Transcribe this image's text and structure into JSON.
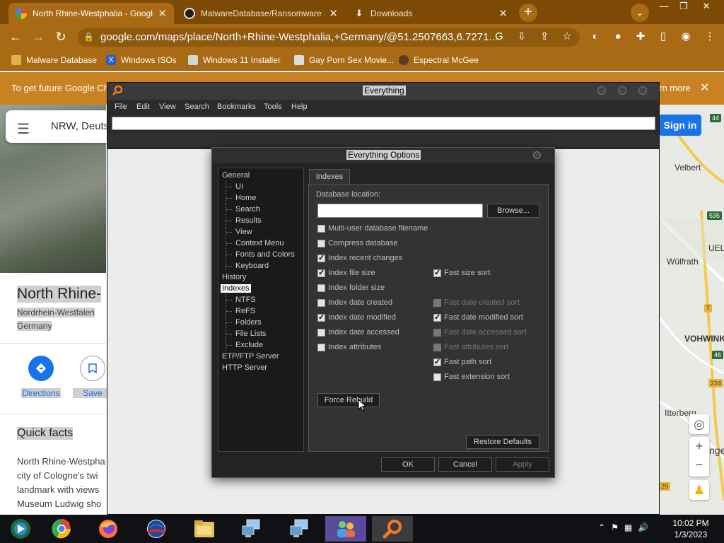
{
  "browser": {
    "tabs": [
      {
        "label": "North Rhine-Westphalia - Google",
        "icon": "google-maps-icon",
        "active": true
      },
      {
        "label": "MalwareDatabase/Ransomware a",
        "icon": "github-icon",
        "active": false
      },
      {
        "label": "Downloads",
        "icon": "download-icon",
        "active": false
      }
    ],
    "address": "google.com/maps/place/North+Rhine-Westphalia,+Germany/@51.2507663,6.7271...",
    "bookmarks": [
      {
        "label": "Malware Database",
        "icon": "folder-icon"
      },
      {
        "label": "Windows ISOs",
        "icon": "x-icon"
      },
      {
        "label": "Windows 11 Installer",
        "icon": "image-icon"
      },
      {
        "label": "Gay Porn Sex Movie...",
        "icon": "site-icon"
      },
      {
        "label": "Espectral McGee",
        "icon": "avatar-icon"
      }
    ],
    "infobar": {
      "text": "To get future Google Ch",
      "more": "rn more"
    },
    "accent": "#a86a14"
  },
  "maps": {
    "search_text": "NRW, Deuts",
    "title": "North Rhine-",
    "subtitle1": "Nordrhein-Westfalen",
    "subtitle2": "Germany",
    "actions": [
      {
        "label": "Directions"
      },
      {
        "label": "Save"
      }
    ],
    "quick_facts_heading": "Quick facts",
    "facts_lines": [
      "North Rhine-Westpha",
      "city of Cologne's twi",
      "landmark with views",
      "Museum Ludwig sho"
    ],
    "sign_in": "Sign in",
    "map_labels": [
      "Velbert",
      "UEL",
      "Wülfrath",
      "VOHWINK",
      "Itterberg",
      "nge"
    ],
    "road_shields": [
      "44",
      "535",
      "7",
      "46",
      "224",
      "29"
    ]
  },
  "everything": {
    "title": "Everything",
    "menu": [
      "File",
      "Edit",
      "View",
      "Search",
      "Bookmarks",
      "Tools",
      "Help"
    ]
  },
  "options": {
    "title": "Everything Options",
    "tree": [
      {
        "label": "General",
        "level": 0
      },
      {
        "label": "UI",
        "level": 1
      },
      {
        "label": "Home",
        "level": 1
      },
      {
        "label": "Search",
        "level": 1
      },
      {
        "label": "Results",
        "level": 1
      },
      {
        "label": "View",
        "level": 1
      },
      {
        "label": "Context Menu",
        "level": 1
      },
      {
        "label": "Fonts and Colors",
        "level": 1
      },
      {
        "label": "Keyboard",
        "level": 1
      },
      {
        "label": "History",
        "level": 0
      },
      {
        "label": "Indexes",
        "level": 0,
        "selected": true
      },
      {
        "label": "NTFS",
        "level": 1
      },
      {
        "label": "ReFS",
        "level": 1
      },
      {
        "label": "Folders",
        "level": 1
      },
      {
        "label": "File Lists",
        "level": 1
      },
      {
        "label": "Exclude",
        "level": 1
      },
      {
        "label": "ETP/FTP Server",
        "level": 0
      },
      {
        "label": "HTTP Server",
        "level": 0
      }
    ],
    "tab": "Indexes",
    "db_location_label": "Database location:",
    "db_location_value": "",
    "browse": "Browse...",
    "left_checks": [
      {
        "label": "Multi-user database filename",
        "checked": false,
        "disabled": false
      },
      {
        "label": "Compress database",
        "checked": false,
        "disabled": false
      },
      {
        "label": "Index recent changes",
        "checked": true,
        "disabled": false
      },
      {
        "label": "Index file size",
        "checked": true,
        "disabled": false
      },
      {
        "label": "Index folder size",
        "checked": false,
        "disabled": false
      },
      {
        "label": "Index date created",
        "checked": false,
        "disabled": false
      },
      {
        "label": "Index date modified",
        "checked": true,
        "disabled": false
      },
      {
        "label": "Index date accessed",
        "checked": false,
        "disabled": false
      },
      {
        "label": "Index attributes",
        "checked": false,
        "disabled": false
      }
    ],
    "right_checks": [
      {
        "label": "Fast size sort",
        "checked": true,
        "disabled": false
      },
      {
        "label": "Fast date created sort",
        "checked": false,
        "disabled": true
      },
      {
        "label": "Fast date modified sort",
        "checked": true,
        "disabled": false
      },
      {
        "label": "Fast date accessed sort",
        "checked": false,
        "disabled": true
      },
      {
        "label": "Fast attributes sort",
        "checked": false,
        "disabled": true
      },
      {
        "label": "Fast path sort",
        "checked": true,
        "disabled": false
      },
      {
        "label": "Fast extension sort",
        "checked": false,
        "disabled": false
      }
    ],
    "force_rebuild": "Force Rebuild",
    "restore_defaults": "Restore Defaults",
    "ok": "OK",
    "cancel": "Cancel",
    "apply": "Apply"
  },
  "taskbar": {
    "apps": [
      "windows-media-center-icon",
      "chrome-icon",
      "firefox-icon",
      "obama-logo-icon",
      "file-explorer-icon",
      "computer-network-icon",
      "computer-network-icon-2",
      "people-icon",
      "everything-search-icon"
    ],
    "time": "10:02 PM",
    "date": "1/3/2023"
  }
}
